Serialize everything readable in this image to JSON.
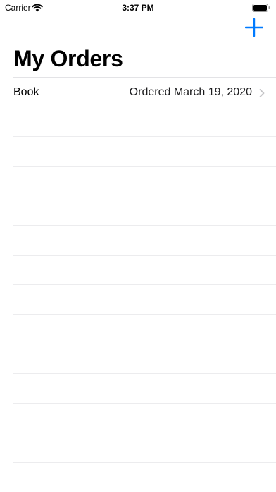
{
  "status_bar": {
    "carrier": "Carrier",
    "time": "3:37 PM"
  },
  "nav": {
    "title": "My Orders",
    "add_icon": "plus-icon"
  },
  "colors": {
    "accent": "#007aff",
    "separator": "#e3e3e6",
    "chevron": "#c4c4c7"
  },
  "orders": [
    {
      "title": "Book",
      "detail": "Ordered March 19, 2020"
    }
  ]
}
